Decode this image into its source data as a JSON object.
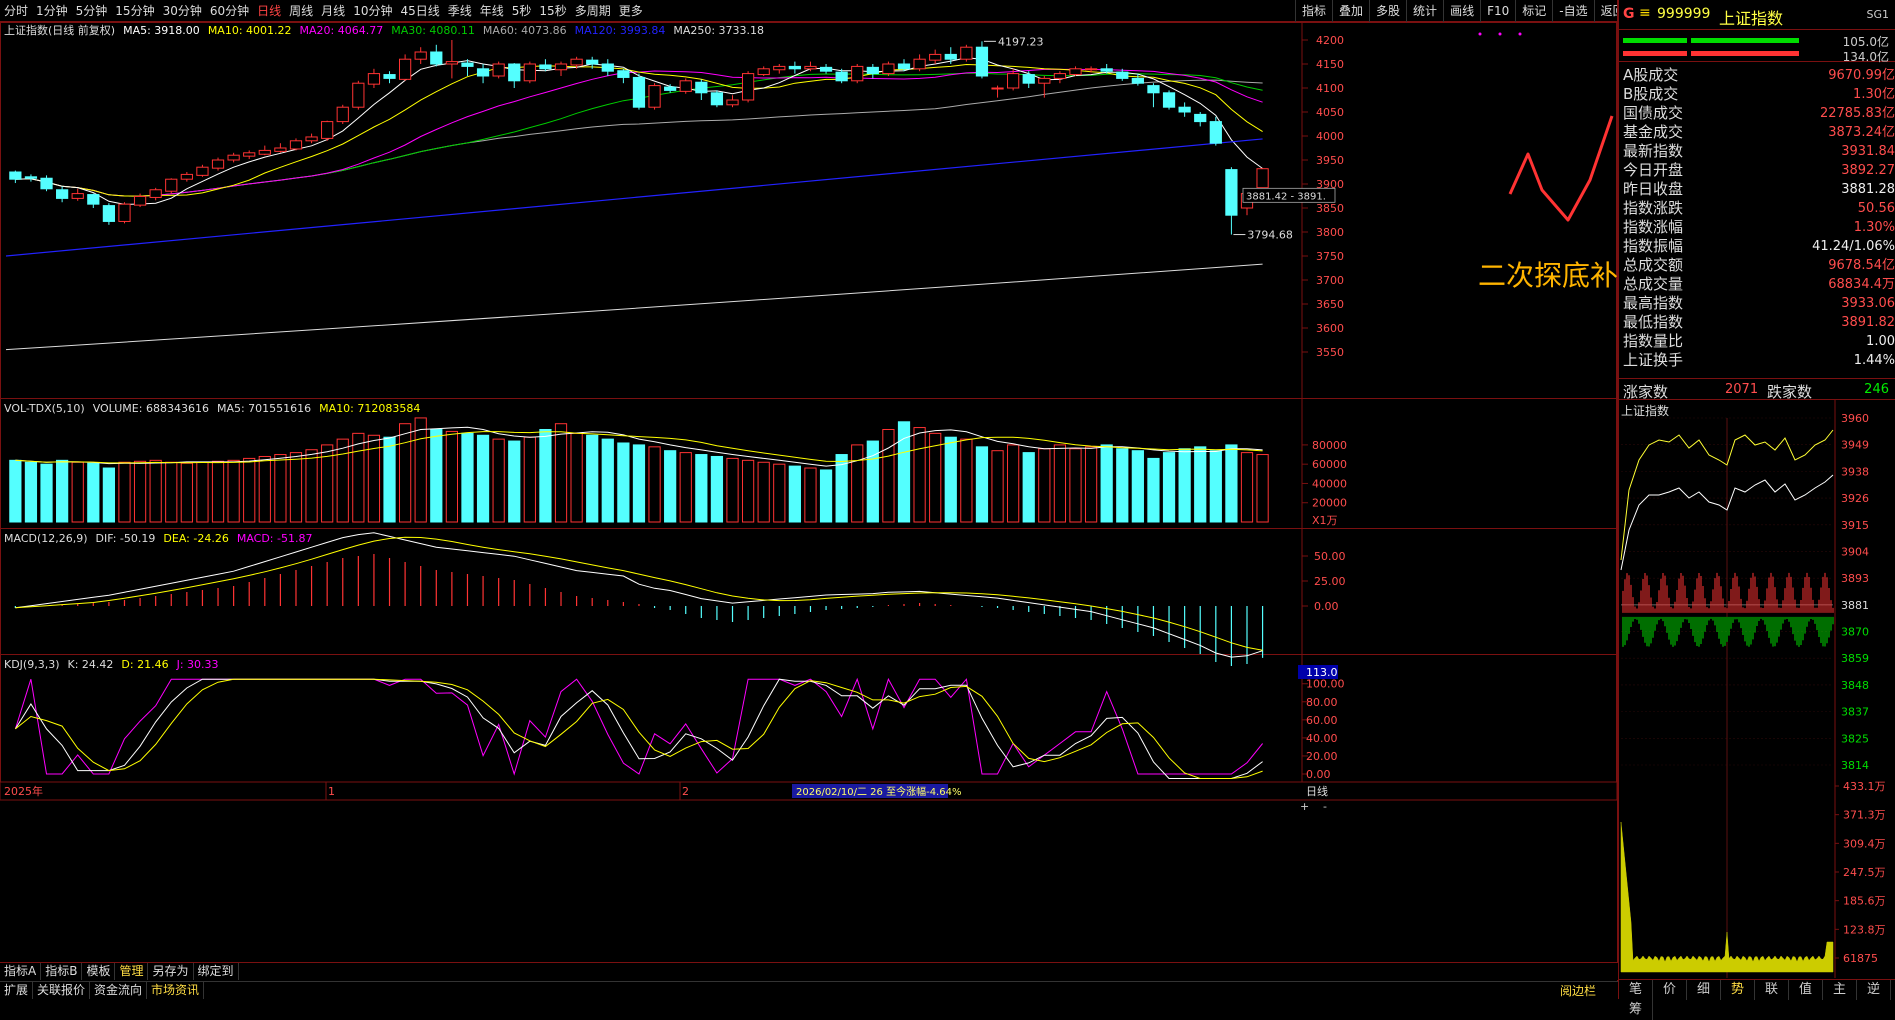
{
  "period_tabs": [
    "分时",
    "1分钟",
    "5分钟",
    "15分钟",
    "30分钟",
    "60分钟",
    "日线",
    "周线",
    "月线",
    "10分钟",
    "45日线",
    "季线",
    "年线",
    "5秒",
    "15秒",
    "多周期",
    "更多"
  ],
  "active_period": "日线",
  "toolbar_right": [
    "指标",
    "叠加",
    "多股",
    "统计",
    "画线",
    "F10",
    "标记",
    "-自选",
    "返回"
  ],
  "main_info": {
    "name": "上证指数(日线 前复权)",
    "ma5": "MA5: 3918.00",
    "ma10": "MA10: 4001.22",
    "ma20": "MA20: 4064.77",
    "ma30": "MA30: 4080.11",
    "ma60": "MA60: 4073.86",
    "ma120": "MA120: 3993.84",
    "ma250": "MA250: 3733.18"
  },
  "vol_info": {
    "name": "VOL-TDX(5,10)",
    "volume": "VOLUME: 688343616",
    "ma5": "MA5: 701551616",
    "ma10": "MA10: 712083584"
  },
  "macd_info": {
    "name": "MACD(12,26,9)",
    "dif": "DIF: -50.19",
    "dea": "DEA: -24.26",
    "macd": "MACD: -51.87"
  },
  "kdj_info": {
    "name": "KDJ(9,3,3)",
    "k": "K: 24.42",
    "d": "D: 21.46",
    "j": "J: 30.33"
  },
  "price_axis": [
    "4200",
    "4150",
    "4100",
    "4050",
    "4000",
    "3950",
    "3900",
    "3850",
    "3800",
    "3750",
    "3700",
    "3650",
    "3600",
    "3550"
  ],
  "vol_axis": [
    "80000",
    "60000",
    "40000",
    "20000",
    "X1万"
  ],
  "macd_axis": [
    "50.00",
    "25.00",
    "0.00"
  ],
  "kdj_axis": [
    "113.0",
    "100.00",
    "80.00",
    "60.00",
    "40.00",
    "20.00",
    "0.00"
  ],
  "annotations": {
    "high_label": "4197.23",
    "low_label": "3794.68",
    "box_label": "3881.42 - 3891.",
    "main_text": "二次探底补缺"
  },
  "x_axis": {
    "start": "2025年",
    "mark1": "1",
    "mark2": "2",
    "highlight": "2026/02/10/二  26  至今涨幅-4.64%",
    "period": "日线"
  },
  "right_panel": {
    "header": {
      "letter": "G",
      "code": "999999",
      "name": "上证指数",
      "tag": "SG1"
    },
    "bar_values": [
      "105.0亿",
      "134.0亿"
    ],
    "rows": [
      {
        "k": "A股成交",
        "v": "9670.99亿",
        "c": "r"
      },
      {
        "k": "B股成交",
        "v": "1.30亿",
        "c": "r"
      },
      {
        "k": "国债成交",
        "v": "22785.83亿",
        "c": "r"
      },
      {
        "k": "基金成交",
        "v": "3873.24亿",
        "c": "r"
      },
      {
        "k": "最新指数",
        "v": "3931.84",
        "c": "r"
      },
      {
        "k": "今日开盘",
        "v": "3892.27",
        "c": "r"
      },
      {
        "k": "昨日收盘",
        "v": "3881.28",
        "c": "w"
      },
      {
        "k": "指数涨跌",
        "v": "50.56",
        "c": "r"
      },
      {
        "k": "指数涨幅",
        "v": "1.30%",
        "c": "r"
      },
      {
        "k": "指数振幅",
        "v": "41.24/1.06%",
        "c": "w"
      },
      {
        "k": "总成交额",
        "v": "9678.54亿",
        "c": "r"
      },
      {
        "k": "总成交量",
        "v": "68834.4万",
        "c": "r"
      },
      {
        "k": "最高指数",
        "v": "3933.06",
        "c": "r"
      },
      {
        "k": "最低指数",
        "v": "3891.82",
        "c": "r"
      },
      {
        "k": "指数量比",
        "v": "1.00",
        "c": "w"
      },
      {
        "k": "上证换手",
        "v": "1.44%",
        "c": "w"
      }
    ],
    "breadth": {
      "up_label": "涨家数",
      "up": "2071",
      "down_label": "跌家数",
      "down": "246"
    },
    "mini_title": "上证指数",
    "mini_axis": [
      "3960",
      "3949",
      "3938",
      "3926",
      "3915",
      "3904",
      "3893",
      "3881",
      "3870",
      "3859",
      "3848",
      "3837",
      "3825",
      "3814"
    ],
    "mini_vol_axis": [
      "433.1万",
      "371.3万",
      "309.4万",
      "247.5万",
      "185.6万",
      "123.8万",
      "61875"
    ],
    "bottom_tabs": [
      "笔",
      "价",
      "细",
      "势",
      "联",
      "值",
      "主",
      "逆",
      "筹"
    ]
  },
  "bottom_tabs1": [
    "指标A",
    "指标B",
    "模板",
    "管理",
    "另存为",
    "绑定到"
  ],
  "bottom_tabs2": [
    "扩展",
    "关联报价",
    "资金流向",
    "市场资讯"
  ],
  "bottom_right_label": "阅边栏",
  "colors": {
    "up": "#ff3333",
    "down": "#54ffff",
    "ma5": "#ffffff",
    "ma10": "#ffff00",
    "ma20": "#ff00ff",
    "ma30": "#00cc00",
    "ma60": "#aaaaaa",
    "ma120": "#2222ff",
    "ma250": "#dddddd",
    "border": "#7a1010"
  },
  "chart_data": {
    "type": "candlestick",
    "candles": [
      [
        3925,
        3910,
        3928,
        3902
      ],
      [
        3915,
        3912,
        3920,
        3905
      ],
      [
        3912,
        3890,
        3918,
        3885
      ],
      [
        3888,
        3870,
        3895,
        3862
      ],
      [
        3870,
        3880,
        3890,
        3865
      ],
      [
        3878,
        3858,
        3880,
        3850
      ],
      [
        3855,
        3822,
        3860,
        3815
      ],
      [
        3822,
        3858,
        3862,
        3818
      ],
      [
        3856,
        3874,
        3880,
        3852
      ],
      [
        3872,
        3888,
        3892,
        3866
      ],
      [
        3885,
        3910,
        3912,
        3880
      ],
      [
        3910,
        3920,
        3925,
        3905
      ],
      [
        3918,
        3935,
        3940,
        3915
      ],
      [
        3933,
        3950,
        3955,
        3928
      ],
      [
        3950,
        3960,
        3965,
        3945
      ],
      [
        3958,
        3965,
        3970,
        3952
      ],
      [
        3962,
        3970,
        3980,
        3960
      ],
      [
        3968,
        3975,
        3985,
        3965
      ],
      [
        3973,
        3990,
        3995,
        3970
      ],
      [
        3990,
        3998,
        4005,
        3985
      ],
      [
        3995,
        4030,
        4032,
        3990
      ],
      [
        4030,
        4060,
        4065,
        4025
      ],
      [
        4060,
        4110,
        4115,
        4055
      ],
      [
        4108,
        4130,
        4140,
        4100
      ],
      [
        4128,
        4120,
        4135,
        4110
      ],
      [
        4118,
        4160,
        4170,
        4115
      ],
      [
        4160,
        4175,
        4185,
        4150
      ],
      [
        4175,
        4150,
        4190,
        4145
      ],
      [
        4150,
        4155,
        4200,
        4120
      ],
      [
        4152,
        4145,
        4160,
        4125
      ],
      [
        4140,
        4125,
        4150,
        4110
      ],
      [
        4125,
        4150,
        4155,
        4120
      ],
      [
        4150,
        4115,
        4152,
        4100
      ],
      [
        4115,
        4150,
        4155,
        4110
      ],
      [
        4148,
        4140,
        4160,
        4135
      ],
      [
        4138,
        4150,
        4155,
        4125
      ],
      [
        4148,
        4160,
        4165,
        4140
      ],
      [
        4158,
        4150,
        4165,
        4140
      ],
      [
        4150,
        4135,
        4160,
        4125
      ],
      [
        4136,
        4122,
        4140,
        4110
      ],
      [
        4122,
        4060,
        4130,
        4055
      ],
      [
        4060,
        4105,
        4110,
        4055
      ],
      [
        4102,
        4095,
        4108,
        4090
      ],
      [
        4093,
        4115,
        4120,
        4088
      ],
      [
        4112,
        4090,
        4118,
        4075
      ],
      [
        4090,
        4065,
        4095,
        4060
      ],
      [
        4065,
        4075,
        4085,
        4060
      ],
      [
        4075,
        4130,
        4135,
        4070
      ],
      [
        4128,
        4140,
        4145,
        4125
      ],
      [
        4138,
        4145,
        4150,
        4130
      ],
      [
        4145,
        4140,
        4155,
        4130
      ],
      [
        4140,
        4145,
        4155,
        4135
      ],
      [
        4143,
        4135,
        4150,
        4130
      ],
      [
        4133,
        4115,
        4140,
        4110
      ],
      [
        4115,
        4145,
        4150,
        4110
      ],
      [
        4143,
        4130,
        4150,
        4120
      ],
      [
        4130,
        4150,
        4155,
        4125
      ],
      [
        4150,
        4140,
        4160,
        4135
      ],
      [
        4140,
        4160,
        4170,
        4135
      ],
      [
        4158,
        4170,
        4180,
        4150
      ],
      [
        4170,
        4160,
        4185,
        4150
      ],
      [
        4160,
        4185,
        4190,
        4155
      ],
      [
        4185,
        4125,
        4197.23,
        4120
      ],
      [
        4100,
        4100,
        4105,
        4080
      ],
      [
        4100,
        4130,
        4140,
        4095
      ],
      [
        4128,
        4110,
        4135,
        4100
      ],
      [
        4110,
        4120,
        4125,
        4080
      ],
      [
        4120,
        4130,
        4135,
        4110
      ],
      [
        4128,
        4140,
        4145,
        4125
      ],
      [
        4138,
        4140,
        4145,
        4132
      ],
      [
        4140,
        4135,
        4150,
        4130
      ],
      [
        4133,
        4120,
        4140,
        4115
      ],
      [
        4120,
        4110,
        4130,
        4105
      ],
      [
        4105,
        4090,
        4110,
        4060
      ],
      [
        4090,
        4060,
        4095,
        4055
      ],
      [
        4060,
        4050,
        4070,
        4040
      ],
      [
        4045,
        4030,
        4050,
        4020
      ],
      [
        4030,
        3985,
        4040,
        3980
      ],
      [
        3930,
        3835,
        3935,
        3794.68
      ],
      [
        3850,
        3880,
        3890,
        3835
      ],
      [
        3892.27,
        3931.84,
        3933.06,
        3891.82
      ]
    ],
    "ma": {
      "ma5": 3918.0,
      "ma10": 4001.22,
      "ma20": 4064.77,
      "ma30": 4080.11,
      "ma60": 4073.86,
      "ma120": 3993.84,
      "ma250": 3733.18
    },
    "volume": [
      64,
      62,
      60,
      64,
      62,
      61,
      56,
      62,
      63,
      64,
      62,
      61,
      62,
      63,
      64,
      66,
      68,
      70,
      72,
      75,
      80,
      86,
      92,
      90,
      88,
      102,
      108,
      96,
      94,
      92,
      90,
      86,
      84,
      88,
      96,
      102,
      92,
      90,
      86,
      82,
      80,
      78,
      74,
      72,
      70,
      68,
      66,
      64,
      62,
      60,
      58,
      56,
      54,
      70,
      80,
      84,
      96,
      104,
      98,
      92,
      88,
      86,
      78,
      74,
      80,
      72,
      76,
      80,
      76,
      78,
      80,
      76,
      74,
      66,
      72,
      76,
      78,
      74,
      80,
      72,
      70
    ],
    "macd_hist": [
      -2,
      -1,
      0,
      1,
      2,
      3,
      4,
      6,
      8,
      10,
      12,
      14,
      16,
      18,
      20,
      24,
      28,
      32,
      36,
      40,
      44,
      48,
      50,
      52,
      48,
      44,
      40,
      36,
      34,
      32,
      30,
      28,
      26,
      22,
      18,
      14,
      10,
      8,
      6,
      4,
      2,
      -2,
      -4,
      -8,
      -12,
      -14,
      -16,
      -14,
      -12,
      -10,
      -8,
      -6,
      -4,
      -3,
      -2,
      -1,
      1,
      2,
      3,
      2,
      1,
      0,
      -1,
      -2,
      -4,
      -6,
      -8,
      -10,
      -12,
      -14,
      -18,
      -22,
      -26,
      -30,
      -36,
      -42,
      -48,
      -56,
      -60,
      -58,
      -51.87
    ]
  }
}
